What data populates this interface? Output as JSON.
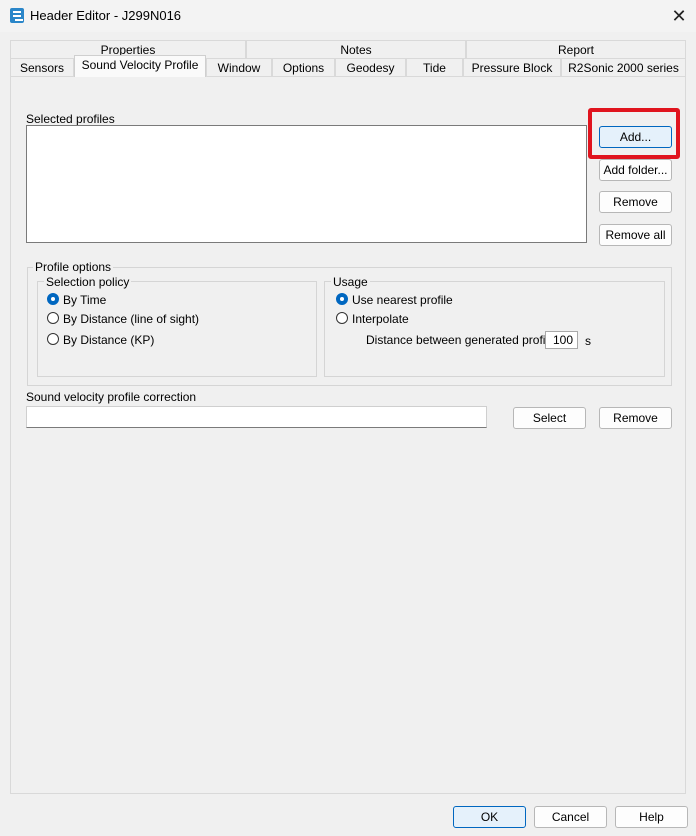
{
  "window": {
    "title": "Header Editor - J299N016",
    "close_glyph": "✕"
  },
  "tabs_top": [
    "Properties",
    "Notes",
    "Report"
  ],
  "tabs_bottom": [
    "Sensors",
    "Sound Velocity Profile",
    "Window",
    "Options",
    "Geodesy",
    "Tide",
    "Pressure Block",
    "R2Sonic 2000 series"
  ],
  "active_tab": "Sound Velocity Profile",
  "selected_profiles": {
    "label": "Selected profiles",
    "items": [],
    "buttons": {
      "add": "Add...",
      "add_folder": "Add folder...",
      "remove": "Remove",
      "remove_all": "Remove all"
    }
  },
  "profile_options": {
    "label": "Profile options",
    "selection_policy": {
      "label": "Selection policy",
      "options": [
        "By Time",
        "By Distance (line of sight)",
        "By Distance (KP)"
      ],
      "selected": "By Time"
    },
    "usage": {
      "label": "Usage",
      "options": [
        "Use nearest profile",
        "Interpolate"
      ],
      "selected": "Use nearest profile",
      "distance_label": "Distance between generated profiles",
      "distance_value": "100",
      "distance_unit": "s"
    }
  },
  "correction": {
    "label": "Sound velocity profile correction",
    "value": "",
    "select_label": "Select",
    "remove_label": "Remove"
  },
  "footer": {
    "ok": "OK",
    "cancel": "Cancel",
    "help": "Help"
  },
  "colors": {
    "highlight": "#e0141e",
    "accent": "#0067c0"
  }
}
